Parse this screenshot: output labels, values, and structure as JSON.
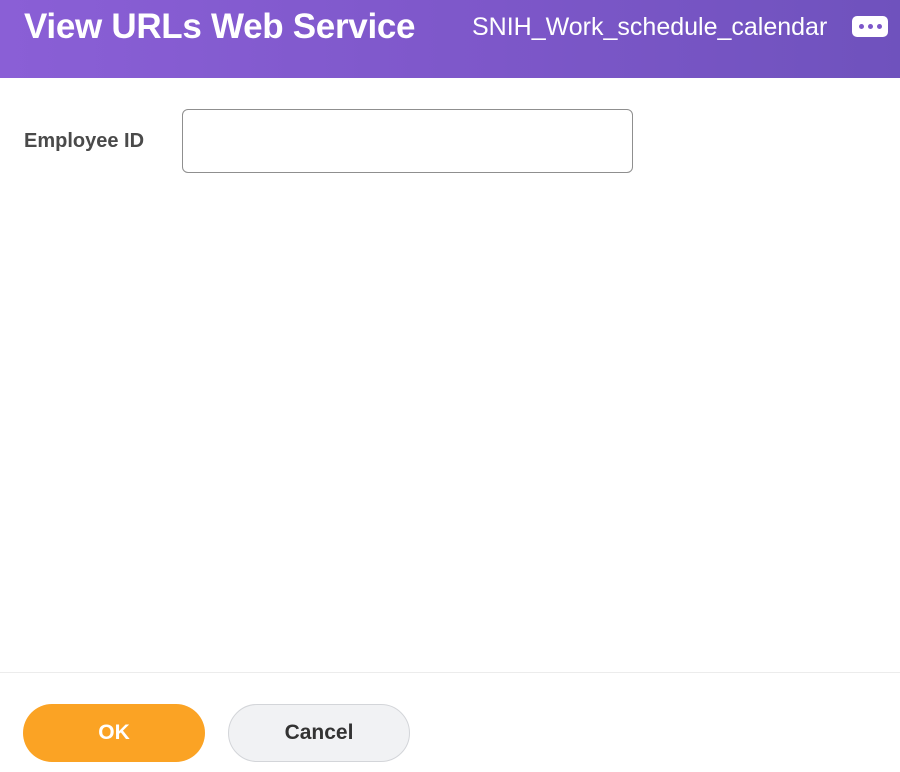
{
  "header": {
    "title": "View URLs Web Service",
    "context": "SNIH_Work_schedule_calendar",
    "more_icon": "ellipsis-icon"
  },
  "form": {
    "employee_id": {
      "label": "Employee ID",
      "value": "",
      "placeholder": ""
    }
  },
  "footer": {
    "ok_label": "OK",
    "cancel_label": "Cancel"
  },
  "colors": {
    "header_bg": "#7d57c9",
    "ok_button": "#fba324",
    "cancel_button": "#f1f2f4"
  }
}
